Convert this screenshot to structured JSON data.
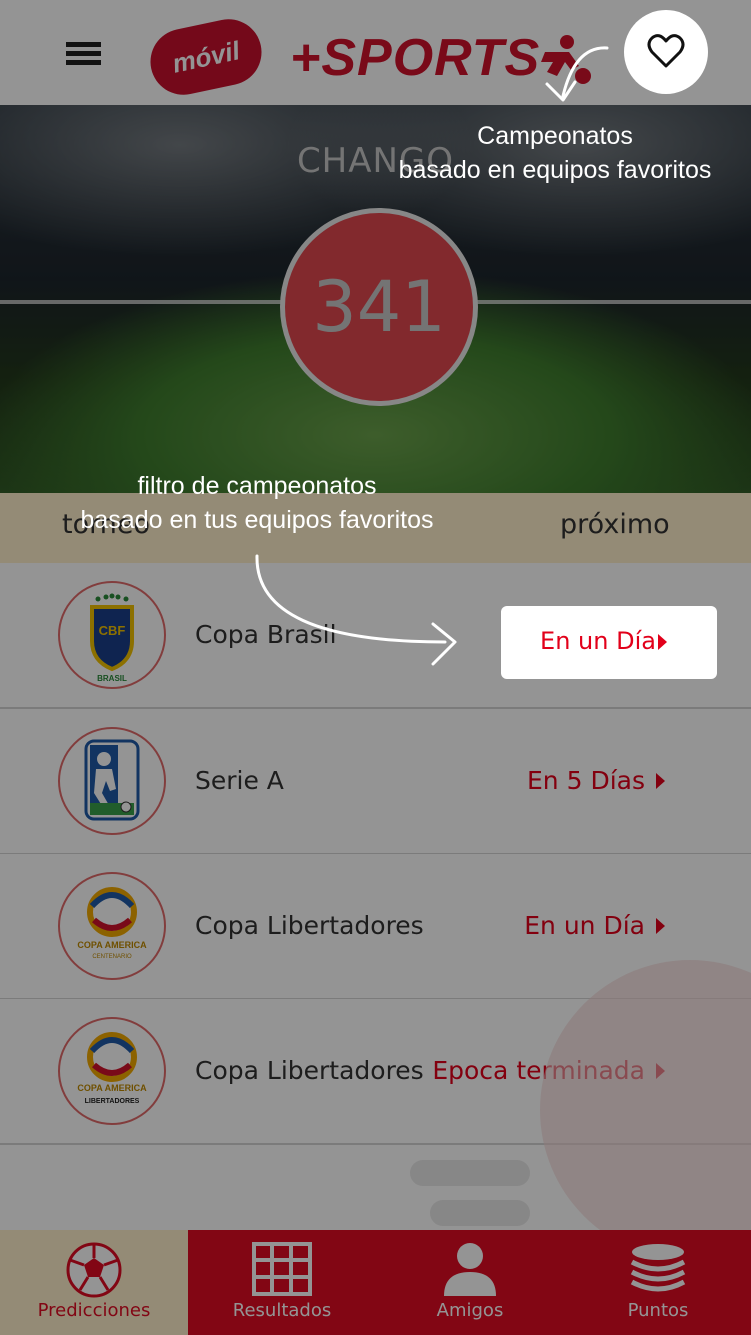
{
  "header": {
    "brand_movil": "móvil",
    "brand_sports": "+SPORTS"
  },
  "hero": {
    "user_name": "CHANGO",
    "score": "341"
  },
  "tabs": {
    "left_label": "torneo",
    "right_label": "próximo"
  },
  "tournaments": [
    {
      "name": "Copa Brasil",
      "status": "En un Día",
      "logo": "cbf-brasil-crest"
    },
    {
      "name": "Serie A",
      "status": "En 5 Días",
      "logo": "serie-a-shield"
    },
    {
      "name": "Copa Libertadores",
      "status": "En un Día",
      "logo": "copa-america-centenario",
      "logo_text_1": "COPA AMERICA",
      "logo_text_2": "CENTENARIO"
    },
    {
      "name": "Copa Libertadores",
      "status": "Epoca terminada",
      "logo": "copa-america-libertadores",
      "logo_text_1": "COPA AMERICA",
      "logo_text_2": "LIBERTADORES"
    }
  ],
  "bottom_nav": [
    {
      "label": "Predicciones",
      "icon": "soccer-ball-icon",
      "active": true
    },
    {
      "label": "Resultados",
      "icon": "grid-icon",
      "active": false
    },
    {
      "label": "Amigos",
      "icon": "person-icon",
      "active": false
    },
    {
      "label": "Puntos",
      "icon": "coins-stack-icon",
      "active": false
    }
  ],
  "onboarding": {
    "tip_favorites_line1": "Campeonatos",
    "tip_favorites_line2": "basado en equipos favoritos",
    "tip_filter_line1": "filtro de campeonatos",
    "tip_filter_line2": "basado en tus equipos favoritos",
    "highlight_status": "En un Día"
  },
  "colors": {
    "brand_red": "#e10c24",
    "accent_cream": "#fff0cc",
    "overlay": "rgba(0,0,0,0.42)"
  }
}
